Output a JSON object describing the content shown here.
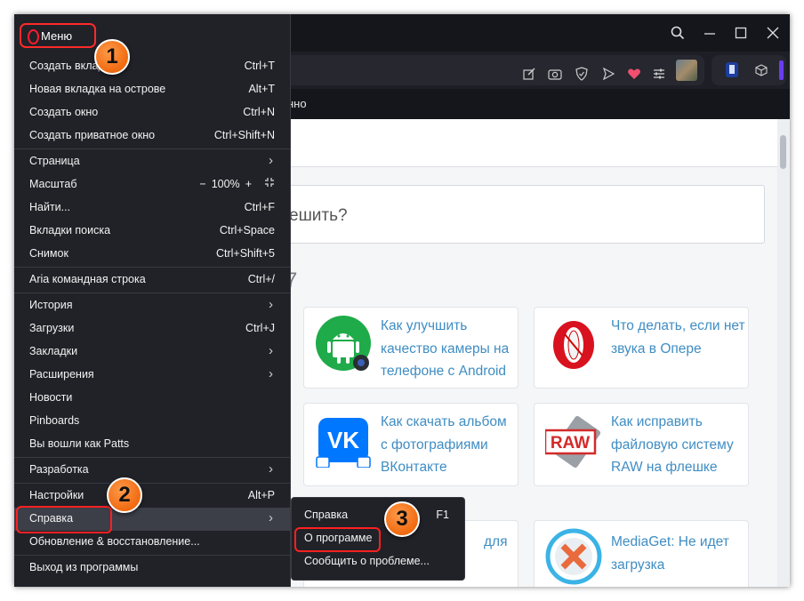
{
  "menu": {
    "title": "Меню",
    "items": [
      {
        "label": "Создать вкладку",
        "shortcut": "Ctrl+T"
      },
      {
        "label": "Новая вкладка на острове",
        "shortcut": "Alt+T"
      },
      {
        "label": "Создать окно",
        "shortcut": "Ctrl+N"
      },
      {
        "label": "Создать приватное окно",
        "shortcut": "Ctrl+Shift+N"
      },
      {
        "label": "Страница",
        "shortcut": ""
      },
      {
        "label": "Масштаб",
        "shortcut": ""
      },
      {
        "label": "Найти...",
        "shortcut": "Ctrl+F"
      },
      {
        "label": "Вкладки поиска",
        "shortcut": "Ctrl+Space"
      },
      {
        "label": "Снимок",
        "shortcut": "Ctrl+Shift+5"
      },
      {
        "label": "Aria командная строка",
        "shortcut": "Ctrl+/"
      },
      {
        "label": "История",
        "shortcut": ""
      },
      {
        "label": "Загрузки",
        "shortcut": "Ctrl+J"
      },
      {
        "label": "Закладки",
        "shortcut": ""
      },
      {
        "label": "Расширения",
        "shortcut": ""
      },
      {
        "label": "Новости",
        "shortcut": ""
      },
      {
        "label": "Pinboards",
        "shortcut": ""
      },
      {
        "label": "Вы вошли как Patts",
        "shortcut": ""
      },
      {
        "label": "Разработка",
        "shortcut": ""
      },
      {
        "label": "Настройки",
        "shortcut": "Alt+P"
      },
      {
        "label": "Справка",
        "shortcut": ""
      },
      {
        "label": "Обновление & восстановление...",
        "shortcut": ""
      },
      {
        "label": "Выход из программы",
        "shortcut": ""
      }
    ],
    "zoom": {
      "minus": "−",
      "value": "100%",
      "plus": "+"
    }
  },
  "submenu": {
    "items": [
      {
        "label": "Справка",
        "shortcut": "F1"
      },
      {
        "label": "О программе",
        "shortcut": ""
      },
      {
        "label": "Сообщить о проблеме...",
        "shortcut": ""
      }
    ]
  },
  "badges": [
    "1",
    "2",
    "3"
  ],
  "bookmarks_bar": {
    "partial_text": "нно"
  },
  "page": {
    "search_partial": "ешить?",
    "number_partial": "7",
    "cards": [
      {
        "text": "Как улучшить качество камеры на телефоне с Android"
      },
      {
        "text": "Что делать, если нет звука в Опере"
      },
      {
        "text": "Как скачать альбом с фотографиями ВКонтакте"
      },
      {
        "text": "Как исправить файловую систему RAW на флешке"
      },
      {
        "text": "для"
      },
      {
        "text": "MediaGet: Не идет загрузка"
      }
    ],
    "raw_label": "RAW"
  },
  "colors": {
    "accent_red": "#ff2a2a",
    "badge_orange": "#f06a10",
    "link_blue": "#3f8dc3"
  }
}
